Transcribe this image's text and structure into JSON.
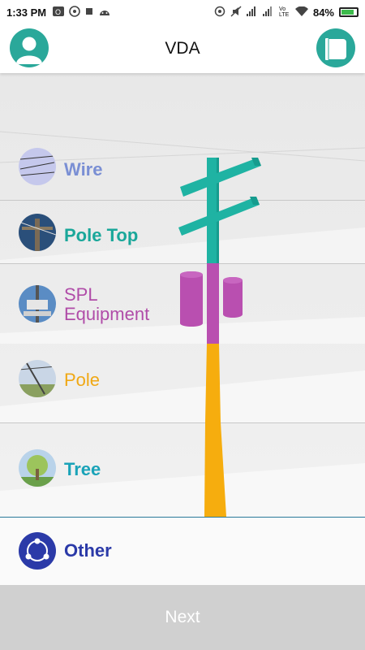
{
  "status": {
    "time": "1:33 PM",
    "left_icons": [
      "outlook-icon",
      "whatsapp-icon",
      "square-icon",
      "android-icon"
    ],
    "right_icons": [
      "hotspot-icon",
      "mute-icon",
      "signal-icon",
      "signal-icon",
      "volte-icon",
      "wifi-icon"
    ],
    "volte_text": "Vo LTE",
    "battery_percent": "84%",
    "battery_level": 0.84
  },
  "header": {
    "title": "VDA",
    "left_icon": "user-avatar-icon",
    "right_icon": "notebook-icon"
  },
  "categories": [
    {
      "label": "Wire",
      "color": "#7a8fd4",
      "bold": true
    },
    {
      "label": "Pole Top",
      "color": "#1aa79a",
      "bold": true
    },
    {
      "label": "SPL\nEquipment",
      "color": "#b04ca8",
      "bold": false
    },
    {
      "label": "Pole",
      "color": "#f0a814",
      "bold": false
    },
    {
      "label": "Tree",
      "color": "#1aa3b8",
      "bold": true
    },
    {
      "label": "Other",
      "color": "#2b3aa8",
      "bold": true
    }
  ],
  "footer": {
    "next_label": "Next"
  },
  "colors": {
    "teal": "#1fb3a3",
    "magenta": "#b94fb0",
    "orange": "#f6ad0e",
    "accent_blue": "#2a7a9a"
  }
}
